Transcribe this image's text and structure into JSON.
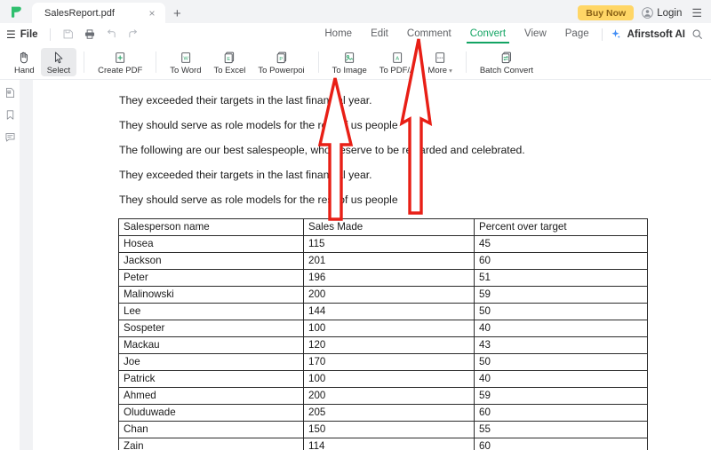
{
  "app": {
    "logo_icon": "afirstsoft-leaf-logo",
    "tab": {
      "title": "SalesReport.pdf",
      "close_icon": "×",
      "new_tab_icon": "+"
    },
    "buy_now_label": "Buy Now",
    "login_label": "Login",
    "account_icon": "user-avatar-icon",
    "window_menu_icon": "hamburger-icon"
  },
  "menu": {
    "hamburger_icon": "hamburger-icon",
    "file_label": "File",
    "quick_actions": [
      {
        "name": "save-icon",
        "title": "Save"
      },
      {
        "name": "print-icon",
        "title": "Print"
      },
      {
        "name": "undo-icon",
        "title": "Undo"
      },
      {
        "name": "redo-icon",
        "title": "Redo"
      }
    ],
    "tabs": [
      {
        "label": "Home",
        "active": false
      },
      {
        "label": "Edit",
        "active": false
      },
      {
        "label": "Comment",
        "active": false
      },
      {
        "label": "Convert",
        "active": true
      },
      {
        "label": "View",
        "active": false
      },
      {
        "label": "Page",
        "active": false
      }
    ],
    "ai_label": "Afirstsoft AI",
    "ai_icon": "sparkle-icon",
    "search_icon": "search-icon"
  },
  "toolbar": {
    "items": [
      {
        "label": "Hand",
        "icon": "hand-icon",
        "selected": false
      },
      {
        "label": "Select",
        "icon": "cursor-arrow-icon",
        "selected": true
      },
      {
        "label": "Create PDF",
        "icon": "create-pdf-icon",
        "selected": false
      },
      {
        "label": "To Word",
        "icon": "to-word-icon",
        "selected": false
      },
      {
        "label": "To Excel",
        "icon": "to-excel-icon",
        "selected": false
      },
      {
        "label": "To Powerpoi",
        "icon": "to-powerpoint-icon",
        "selected": false
      },
      {
        "label": "To Image",
        "icon": "to-image-icon",
        "selected": false
      },
      {
        "label": "To PDF/A",
        "icon": "to-pdfa-icon",
        "selected": false
      },
      {
        "label": "More",
        "icon": "more-icon",
        "selected": false,
        "caret": "▾"
      },
      {
        "label": "Batch Convert",
        "icon": "batch-convert-icon",
        "selected": false
      }
    ]
  },
  "left_rail": {
    "items": [
      {
        "name": "thumbnails-icon"
      },
      {
        "name": "bookmark-icon"
      },
      {
        "name": "comment-icon"
      }
    ]
  },
  "document": {
    "paragraphs": [
      "They exceeded their targets in the last financial year.",
      "They should serve as role models for the rest of us people",
      "The following are our best salespeople, who deserve to be rewarded and celebrated.",
      "They exceeded their targets in the last financial year.",
      "They should serve as role models for the rest of us people"
    ],
    "table": {
      "headers": [
        "Salesperson name",
        "Sales Made",
        "Percent over target"
      ],
      "rows": [
        [
          "Hosea",
          "115",
          "45"
        ],
        [
          "Jackson",
          "201",
          "60"
        ],
        [
          "Peter",
          "196",
          "51"
        ],
        [
          "Malinowski",
          "200",
          "59"
        ],
        [
          "Lee",
          "144",
          "50"
        ],
        [
          "Sospeter",
          "100",
          "40"
        ],
        [
          "Mackau",
          "120",
          "43"
        ],
        [
          "Joe",
          "170",
          "50"
        ],
        [
          "Patrick",
          "100",
          "40"
        ],
        [
          "Ahmed",
          "200",
          "59"
        ],
        [
          "Oluduwade",
          "205",
          "60"
        ],
        [
          "Chan",
          "150",
          "55"
        ],
        [
          "Zain",
          "114",
          "60"
        ]
      ]
    }
  },
  "annotations": {
    "color": "#e81f16",
    "arrows": [
      {
        "name": "arrow-to-excel",
        "points_to": "To Excel"
      },
      {
        "name": "arrow-to-convert-tab",
        "points_to": "Convert"
      }
    ]
  },
  "colors": {
    "brand_green": "#13a463",
    "buy_now_bg": "#ffd666",
    "buy_now_text": "#8a6116",
    "annotation_red": "#e81f16",
    "tabbar_bg": "#f2f3f5",
    "gutter_bg": "#f1f2f4"
  }
}
